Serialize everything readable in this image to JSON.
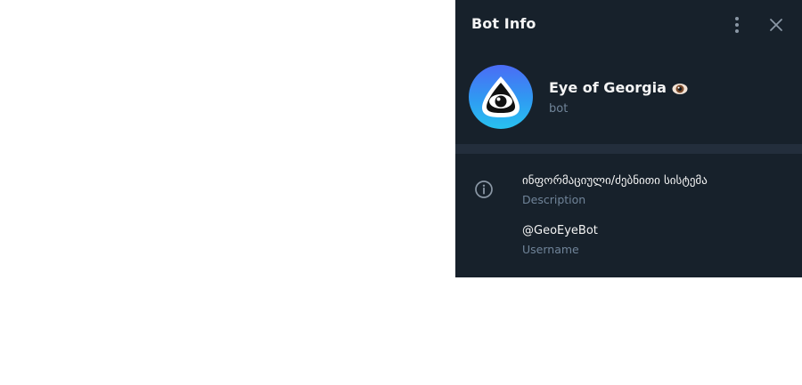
{
  "panel": {
    "title": "Bot Info",
    "colors": {
      "background": "#17212b",
      "divider": "#232e3c",
      "text_primary": "#f5f5f5",
      "text_secondary": "#708499",
      "icon": "#8a97a5"
    }
  },
  "header": {
    "more_icon": "more-vertical-icon",
    "close_icon": "close-icon"
  },
  "profile": {
    "name": "Eye of Georgia",
    "name_emoji_icon": "eye-emoji-icon",
    "subtitle": "bot",
    "avatar_icon": "eye-logo-icon"
  },
  "info": {
    "icon": "info-circle-icon",
    "description": {
      "value": "ინფორმაციული/ძებნითი სისტემა",
      "label": "Description"
    },
    "username": {
      "value": "@GeoEyeBot",
      "label": "Username"
    }
  }
}
